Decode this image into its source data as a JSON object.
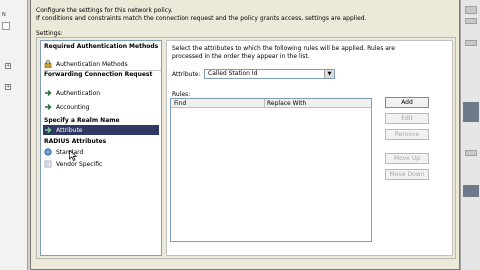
{
  "background": {
    "left_tree": [
      "N",
      "",
      ""
    ],
    "left_plus": [
      "+",
      "+"
    ]
  },
  "dialog": {
    "description_line1": "Configure the settings for this network policy.",
    "description_line2": "If conditions and constraints match the connection request and the policy grants access, settings are applied.",
    "settings_label": "Settings:"
  },
  "nav": {
    "sections": [
      {
        "header": "Required Authentication Methods",
        "items": [
          {
            "label": "Authentication Methods",
            "icon": "lock-icon"
          }
        ]
      },
      {
        "header": "Forwarding Connection Request",
        "items": [
          {
            "label": "Authentication",
            "icon": "arrow-icon"
          },
          {
            "label": "Accounting",
            "icon": "arrow-icon"
          }
        ]
      },
      {
        "header": "Specify a Realm Name",
        "items": [
          {
            "label": "Attribute",
            "icon": "arrow-icon",
            "selected": true
          }
        ]
      },
      {
        "header": "RADIUS Attributes",
        "items": [
          {
            "label": "Standard",
            "icon": "globe-icon"
          },
          {
            "label": "Vendor Specific",
            "icon": "doc-icon"
          }
        ]
      }
    ]
  },
  "pane": {
    "instructions": "Select the attributes to which the following rules will be applied. Rules are processed in the order they appear in the list.",
    "attribute_label": "Attribute:",
    "attribute_value": "Called Station Id",
    "rules_label": "Rules:",
    "columns": [
      "Find",
      "Replace With"
    ],
    "buttons": [
      {
        "label": "Add",
        "enabled": true
      },
      {
        "label": "Edit",
        "enabled": false
      },
      {
        "label": "Remove",
        "enabled": false
      },
      {
        "label": "Move Up",
        "enabled": false
      },
      {
        "label": "Move Down",
        "enabled": false
      }
    ]
  },
  "colors": {
    "selection": "#2e3a63",
    "dialog_bg": "#ece9d8",
    "border_blue": "#7f9db9"
  }
}
